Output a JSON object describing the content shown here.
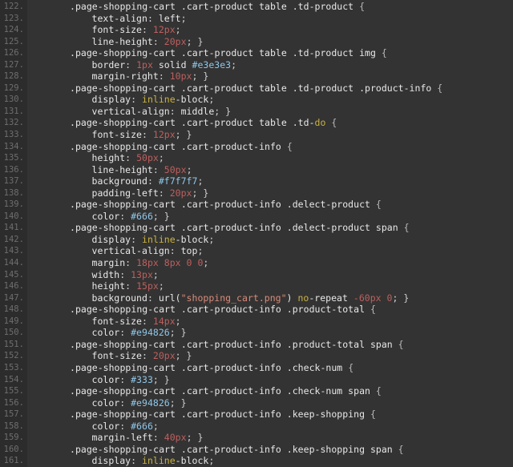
{
  "editor": {
    "name": "css-source-view",
    "language": "CSS",
    "background_color": "#333333",
    "gutter_color": "#2c2c2c",
    "first_line_number": 122,
    "last_line_number": 161,
    "colors": {
      "text": "#e8e8e8",
      "line_number": "#6e6e6e",
      "number_value": "#bf5f5f",
      "hex_value": "#8fc7e8",
      "keyword": "#cbb340",
      "string": "#d98b7a",
      "punctuation": "#d0d0d0"
    },
    "lines": [
      {
        "n": "122.",
        "tokens": [
          {
            "t": ".page-shopping-cart .cart-product table .td-product ",
            "c": "tok-sel"
          },
          {
            "t": "{",
            "c": "tok-brace"
          }
        ],
        "indent": 0
      },
      {
        "n": "123.",
        "tokens": [
          {
            "t": "text-align",
            "c": "tok-prop"
          },
          {
            "t": ": ",
            "c": "tok-punct"
          },
          {
            "t": "left",
            "c": "tok-val"
          },
          {
            "t": ";",
            "c": "tok-punct"
          }
        ],
        "indent": 1
      },
      {
        "n": "124.",
        "tokens": [
          {
            "t": "font-size",
            "c": "tok-prop"
          },
          {
            "t": ": ",
            "c": "tok-punct"
          },
          {
            "t": "12px",
            "c": "tok-num"
          },
          {
            "t": ";",
            "c": "tok-punct"
          }
        ],
        "indent": 1
      },
      {
        "n": "125.",
        "tokens": [
          {
            "t": "line-height",
            "c": "tok-prop"
          },
          {
            "t": ": ",
            "c": "tok-punct"
          },
          {
            "t": "20px",
            "c": "tok-num"
          },
          {
            "t": "; }",
            "c": "tok-punct"
          }
        ],
        "indent": 1
      },
      {
        "n": "126.",
        "tokens": [
          {
            "t": ".page-shopping-cart .cart-product table .td-product img ",
            "c": "tok-sel"
          },
          {
            "t": "{",
            "c": "tok-brace"
          }
        ],
        "indent": 0
      },
      {
        "n": "127.",
        "tokens": [
          {
            "t": "border",
            "c": "tok-prop"
          },
          {
            "t": ": ",
            "c": "tok-punct"
          },
          {
            "t": "1px",
            "c": "tok-num"
          },
          {
            "t": " solid ",
            "c": "tok-val"
          },
          {
            "t": "#e3e3e3",
            "c": "tok-hex"
          },
          {
            "t": ";",
            "c": "tok-punct"
          }
        ],
        "indent": 1
      },
      {
        "n": "128.",
        "tokens": [
          {
            "t": "margin-right",
            "c": "tok-prop"
          },
          {
            "t": ": ",
            "c": "tok-punct"
          },
          {
            "t": "10px",
            "c": "tok-num"
          },
          {
            "t": "; }",
            "c": "tok-punct"
          }
        ],
        "indent": 1
      },
      {
        "n": "129.",
        "tokens": [
          {
            "t": ".page-shopping-cart .cart-product table .td-product .product-info ",
            "c": "tok-sel"
          },
          {
            "t": "{",
            "c": "tok-brace"
          }
        ],
        "indent": 0
      },
      {
        "n": "130.",
        "tokens": [
          {
            "t": "display",
            "c": "tok-prop"
          },
          {
            "t": ": ",
            "c": "tok-punct"
          },
          {
            "t": "inline",
            "c": "tok-kw"
          },
          {
            "t": "-block",
            "c": "tok-val"
          },
          {
            "t": ";",
            "c": "tok-punct"
          }
        ],
        "indent": 1
      },
      {
        "n": "131.",
        "tokens": [
          {
            "t": "vertical-align",
            "c": "tok-prop"
          },
          {
            "t": ": ",
            "c": "tok-punct"
          },
          {
            "t": "middle",
            "c": "tok-val"
          },
          {
            "t": "; }",
            "c": "tok-punct"
          }
        ],
        "indent": 1
      },
      {
        "n": "132.",
        "tokens": [
          {
            "t": ".page-shopping-cart .cart-product table .td-",
            "c": "tok-sel"
          },
          {
            "t": "do",
            "c": "tok-kw"
          },
          {
            "t": " ",
            "c": "tok-sel"
          },
          {
            "t": "{",
            "c": "tok-brace"
          }
        ],
        "indent": 0
      },
      {
        "n": "133.",
        "tokens": [
          {
            "t": "font-size",
            "c": "tok-prop"
          },
          {
            "t": ": ",
            "c": "tok-punct"
          },
          {
            "t": "12px",
            "c": "tok-num"
          },
          {
            "t": "; }",
            "c": "tok-punct"
          }
        ],
        "indent": 1
      },
      {
        "n": "134.",
        "tokens": [
          {
            "t": ".page-shopping-cart .cart-product-info ",
            "c": "tok-sel"
          },
          {
            "t": "{",
            "c": "tok-brace"
          }
        ],
        "indent": 0
      },
      {
        "n": "135.",
        "tokens": [
          {
            "t": "height",
            "c": "tok-prop"
          },
          {
            "t": ": ",
            "c": "tok-punct"
          },
          {
            "t": "50px",
            "c": "tok-num"
          },
          {
            "t": ";",
            "c": "tok-punct"
          }
        ],
        "indent": 1
      },
      {
        "n": "136.",
        "tokens": [
          {
            "t": "line-height",
            "c": "tok-prop"
          },
          {
            "t": ": ",
            "c": "tok-punct"
          },
          {
            "t": "50px",
            "c": "tok-num"
          },
          {
            "t": ";",
            "c": "tok-punct"
          }
        ],
        "indent": 1
      },
      {
        "n": "137.",
        "tokens": [
          {
            "t": "background",
            "c": "tok-prop"
          },
          {
            "t": ": ",
            "c": "tok-punct"
          },
          {
            "t": "#f7f7f7",
            "c": "tok-hex"
          },
          {
            "t": ";",
            "c": "tok-punct"
          }
        ],
        "indent": 1
      },
      {
        "n": "138.",
        "tokens": [
          {
            "t": "padding-left",
            "c": "tok-prop"
          },
          {
            "t": ": ",
            "c": "tok-punct"
          },
          {
            "t": "20px",
            "c": "tok-num"
          },
          {
            "t": "; }",
            "c": "tok-punct"
          }
        ],
        "indent": 1
      },
      {
        "n": "139.",
        "tokens": [
          {
            "t": ".page-shopping-cart .cart-product-info .delect-product ",
            "c": "tok-sel"
          },
          {
            "t": "{",
            "c": "tok-brace"
          }
        ],
        "indent": 0
      },
      {
        "n": "140.",
        "tokens": [
          {
            "t": "color",
            "c": "tok-prop"
          },
          {
            "t": ": ",
            "c": "tok-punct"
          },
          {
            "t": "#666",
            "c": "tok-hex"
          },
          {
            "t": "; }",
            "c": "tok-punct"
          }
        ],
        "indent": 1
      },
      {
        "n": "141.",
        "tokens": [
          {
            "t": ".page-shopping-cart .cart-product-info .delect-product span ",
            "c": "tok-sel"
          },
          {
            "t": "{",
            "c": "tok-brace"
          }
        ],
        "indent": 0
      },
      {
        "n": "142.",
        "tokens": [
          {
            "t": "display",
            "c": "tok-prop"
          },
          {
            "t": ": ",
            "c": "tok-punct"
          },
          {
            "t": "inline",
            "c": "tok-kw"
          },
          {
            "t": "-block",
            "c": "tok-val"
          },
          {
            "t": ";",
            "c": "tok-punct"
          }
        ],
        "indent": 1
      },
      {
        "n": "143.",
        "tokens": [
          {
            "t": "vertical-align",
            "c": "tok-prop"
          },
          {
            "t": ": ",
            "c": "tok-punct"
          },
          {
            "t": "top",
            "c": "tok-val"
          },
          {
            "t": ";",
            "c": "tok-punct"
          }
        ],
        "indent": 1
      },
      {
        "n": "144.",
        "tokens": [
          {
            "t": "margin",
            "c": "tok-prop"
          },
          {
            "t": ": ",
            "c": "tok-punct"
          },
          {
            "t": "18px 8px 0 0",
            "c": "tok-num"
          },
          {
            "t": ";",
            "c": "tok-punct"
          }
        ],
        "indent": 1
      },
      {
        "n": "145.",
        "tokens": [
          {
            "t": "width",
            "c": "tok-prop"
          },
          {
            "t": ": ",
            "c": "tok-punct"
          },
          {
            "t": "13px",
            "c": "tok-num"
          },
          {
            "t": ";",
            "c": "tok-punct"
          }
        ],
        "indent": 1
      },
      {
        "n": "146.",
        "tokens": [
          {
            "t": "height",
            "c": "tok-prop"
          },
          {
            "t": ": ",
            "c": "tok-punct"
          },
          {
            "t": "15px",
            "c": "tok-num"
          },
          {
            "t": ";",
            "c": "tok-punct"
          }
        ],
        "indent": 1
      },
      {
        "n": "147.",
        "tokens": [
          {
            "t": "background",
            "c": "tok-prop"
          },
          {
            "t": ": ",
            "c": "tok-punct"
          },
          {
            "t": "url(",
            "c": "tok-fn"
          },
          {
            "t": "\"shopping_cart.png\"",
            "c": "tok-str"
          },
          {
            "t": ") ",
            "c": "tok-fn"
          },
          {
            "t": "no",
            "c": "tok-kw"
          },
          {
            "t": "-repeat ",
            "c": "tok-val"
          },
          {
            "t": "-60px 0",
            "c": "tok-num"
          },
          {
            "t": "; }",
            "c": "tok-punct"
          }
        ],
        "indent": 1
      },
      {
        "n": "148.",
        "tokens": [
          {
            "t": ".page-shopping-cart .cart-product-info .product-total ",
            "c": "tok-sel"
          },
          {
            "t": "{",
            "c": "tok-brace"
          }
        ],
        "indent": 0
      },
      {
        "n": "149.",
        "tokens": [
          {
            "t": "font-size",
            "c": "tok-prop"
          },
          {
            "t": ": ",
            "c": "tok-punct"
          },
          {
            "t": "14px",
            "c": "tok-num"
          },
          {
            "t": ";",
            "c": "tok-punct"
          }
        ],
        "indent": 1
      },
      {
        "n": "150.",
        "tokens": [
          {
            "t": "color",
            "c": "tok-prop"
          },
          {
            "t": ": ",
            "c": "tok-punct"
          },
          {
            "t": "#e94826",
            "c": "tok-hex"
          },
          {
            "t": "; }",
            "c": "tok-punct"
          }
        ],
        "indent": 1
      },
      {
        "n": "151.",
        "tokens": [
          {
            "t": ".page-shopping-cart .cart-product-info .product-total span ",
            "c": "tok-sel"
          },
          {
            "t": "{",
            "c": "tok-brace"
          }
        ],
        "indent": 0
      },
      {
        "n": "152.",
        "tokens": [
          {
            "t": "font-size",
            "c": "tok-prop"
          },
          {
            "t": ": ",
            "c": "tok-punct"
          },
          {
            "t": "20px",
            "c": "tok-num"
          },
          {
            "t": "; }",
            "c": "tok-punct"
          }
        ],
        "indent": 1
      },
      {
        "n": "153.",
        "tokens": [
          {
            "t": ".page-shopping-cart .cart-product-info .check-num ",
            "c": "tok-sel"
          },
          {
            "t": "{",
            "c": "tok-brace"
          }
        ],
        "indent": 0
      },
      {
        "n": "154.",
        "tokens": [
          {
            "t": "color",
            "c": "tok-prop"
          },
          {
            "t": ": ",
            "c": "tok-punct"
          },
          {
            "t": "#333",
            "c": "tok-hex"
          },
          {
            "t": "; }",
            "c": "tok-punct"
          }
        ],
        "indent": 1
      },
      {
        "n": "155.",
        "tokens": [
          {
            "t": ".page-shopping-cart .cart-product-info .check-num span ",
            "c": "tok-sel"
          },
          {
            "t": "{",
            "c": "tok-brace"
          }
        ],
        "indent": 0
      },
      {
        "n": "156.",
        "tokens": [
          {
            "t": "color",
            "c": "tok-prop"
          },
          {
            "t": ": ",
            "c": "tok-punct"
          },
          {
            "t": "#e94826",
            "c": "tok-hex"
          },
          {
            "t": "; }",
            "c": "tok-punct"
          }
        ],
        "indent": 1
      },
      {
        "n": "157.",
        "tokens": [
          {
            "t": ".page-shopping-cart .cart-product-info .keep-shopping ",
            "c": "tok-sel"
          },
          {
            "t": "{",
            "c": "tok-brace"
          }
        ],
        "indent": 0
      },
      {
        "n": "158.",
        "tokens": [
          {
            "t": "color",
            "c": "tok-prop"
          },
          {
            "t": ": ",
            "c": "tok-punct"
          },
          {
            "t": "#666",
            "c": "tok-hex"
          },
          {
            "t": ";",
            "c": "tok-punct"
          }
        ],
        "indent": 1
      },
      {
        "n": "159.",
        "tokens": [
          {
            "t": "margin-left",
            "c": "tok-prop"
          },
          {
            "t": ": ",
            "c": "tok-punct"
          },
          {
            "t": "40px",
            "c": "tok-num"
          },
          {
            "t": "; }",
            "c": "tok-punct"
          }
        ],
        "indent": 1
      },
      {
        "n": "160.",
        "tokens": [
          {
            "t": ".page-shopping-cart .cart-product-info .keep-shopping span ",
            "c": "tok-sel"
          },
          {
            "t": "{",
            "c": "tok-brace"
          }
        ],
        "indent": 0
      },
      {
        "n": "161.",
        "tokens": [
          {
            "t": "display",
            "c": "tok-prop"
          },
          {
            "t": ": ",
            "c": "tok-punct"
          },
          {
            "t": "inline",
            "c": "tok-kw"
          },
          {
            "t": "-block",
            "c": "tok-val"
          },
          {
            "t": ";",
            "c": "tok-punct"
          }
        ],
        "indent": 1
      }
    ]
  }
}
